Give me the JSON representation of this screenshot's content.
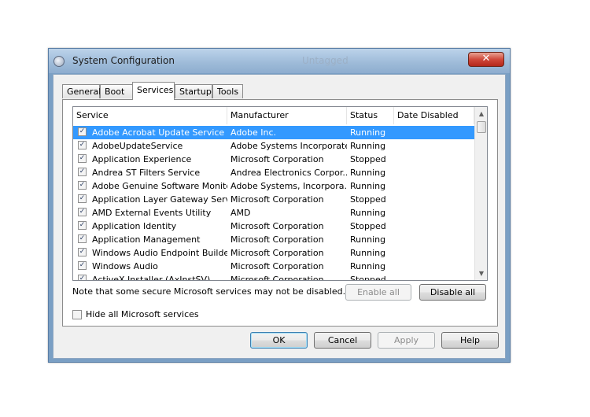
{
  "window": {
    "title": "System Configuration",
    "background_title": "Untagged",
    "close_glyph": "✕",
    "icon": "system-configuration-icon"
  },
  "tabs": [
    {
      "label": "General"
    },
    {
      "label": "Boot"
    },
    {
      "label": "Services",
      "active": true
    },
    {
      "label": "Startup"
    },
    {
      "label": "Tools"
    }
  ],
  "services_list": {
    "columns": {
      "service": "Service",
      "manufacturer": "Manufacturer",
      "status": "Status",
      "date_disabled": "Date Disabled"
    },
    "rows": [
      {
        "checked": true,
        "service": "Adobe Acrobat Update Service",
        "manufacturer": "Adobe Inc.",
        "status": "Running",
        "date_disabled": "",
        "selected": true
      },
      {
        "checked": true,
        "service": "AdobeUpdateService",
        "manufacturer": "Adobe Systems Incorporated",
        "status": "Running",
        "date_disabled": ""
      },
      {
        "checked": true,
        "service": "Application Experience",
        "manufacturer": "Microsoft Corporation",
        "status": "Stopped",
        "date_disabled": ""
      },
      {
        "checked": true,
        "service": "Andrea ST Filters Service",
        "manufacturer": "Andrea Electronics Corpor...",
        "status": "Running",
        "date_disabled": ""
      },
      {
        "checked": true,
        "service": "Adobe Genuine Software Monito...",
        "manufacturer": "Adobe Systems, Incorpora...",
        "status": "Running",
        "date_disabled": ""
      },
      {
        "checked": true,
        "service": "Application Layer Gateway Service",
        "manufacturer": "Microsoft Corporation",
        "status": "Stopped",
        "date_disabled": ""
      },
      {
        "checked": true,
        "service": "AMD External Events Utility",
        "manufacturer": "AMD",
        "status": "Running",
        "date_disabled": ""
      },
      {
        "checked": true,
        "service": "Application Identity",
        "manufacturer": "Microsoft Corporation",
        "status": "Stopped",
        "date_disabled": ""
      },
      {
        "checked": true,
        "service": "Application Management",
        "manufacturer": "Microsoft Corporation",
        "status": "Running",
        "date_disabled": ""
      },
      {
        "checked": true,
        "service": "Windows Audio Endpoint Builder",
        "manufacturer": "Microsoft Corporation",
        "status": "Running",
        "date_disabled": ""
      },
      {
        "checked": true,
        "service": "Windows Audio",
        "manufacturer": "Microsoft Corporation",
        "status": "Running",
        "date_disabled": ""
      },
      {
        "checked": true,
        "service": "ActiveX Installer (AxInstSV)",
        "manufacturer": "Microsoft Corporation",
        "status": "Stopped",
        "date_disabled": ""
      }
    ],
    "scroll_up_glyph": "▲",
    "scroll_down_glyph": "▼"
  },
  "note": "Note that some secure Microsoft services may not be disabled.",
  "enable_all": "Enable all",
  "disable_all": "Disable all",
  "hide_ms": {
    "label": "Hide all Microsoft services",
    "checked": false
  },
  "footer": {
    "ok": "OK",
    "cancel": "Cancel",
    "apply": "Apply",
    "help": "Help"
  },
  "colors": {
    "selection": "#3399ff",
    "title_bar": "#9dbad8",
    "close_button": "#d0493b"
  }
}
